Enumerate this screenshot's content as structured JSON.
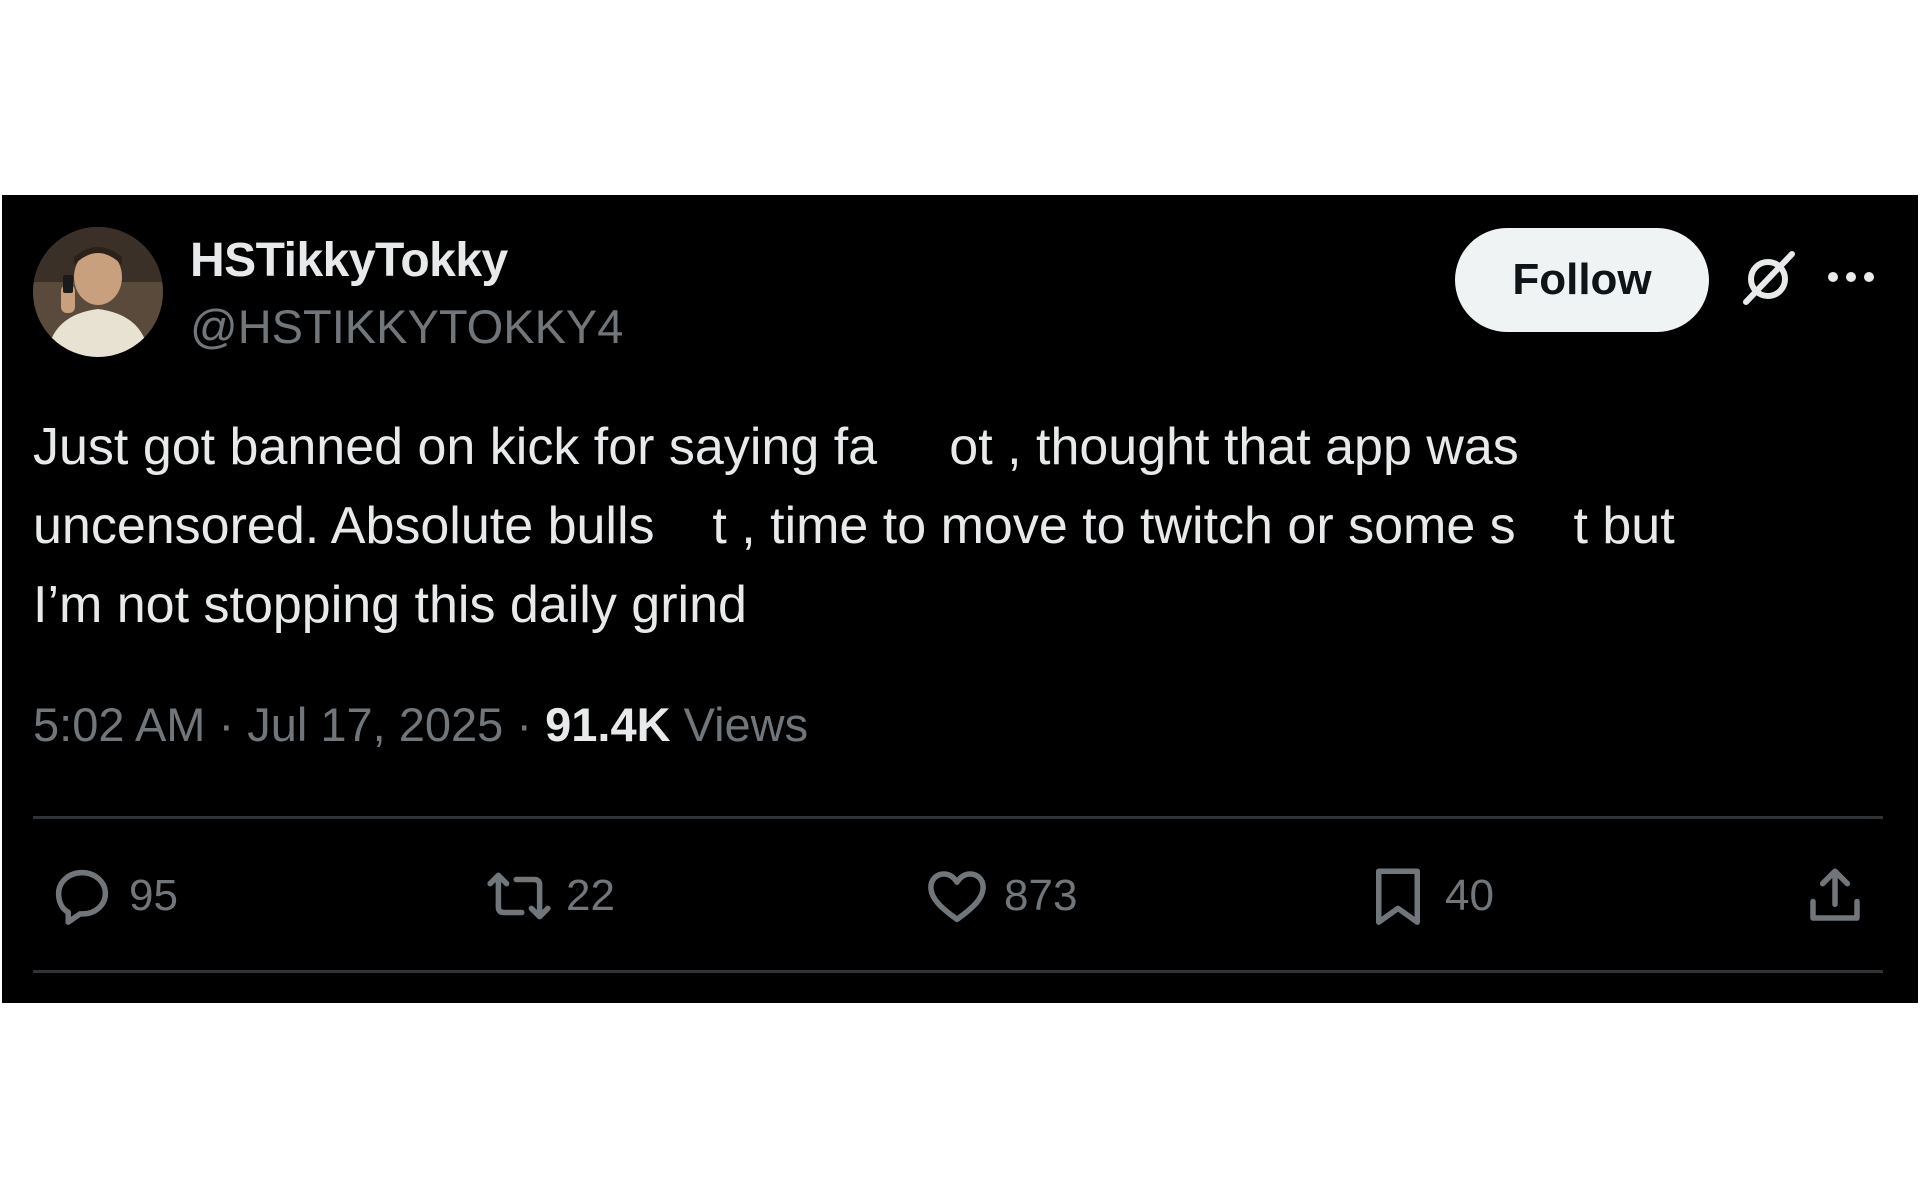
{
  "author": {
    "display_name": "HSTikkyTokky",
    "handle": "@HSTIKKYTOKKY4",
    "avatar_icon": "profile-photo"
  },
  "header": {
    "follow_label": "Follow",
    "grok_icon": "grok-icon",
    "more_icon": "more-icon"
  },
  "tweet": {
    "lines": [
      "Just got banned on kick for saying fa     ot , thought that app was",
      "uncensored. Absolute bulls    t , time to move to twitch or some s    t but",
      "I’m not stopping this daily grind"
    ]
  },
  "meta": {
    "time": "5:02 AM",
    "separator": "·",
    "date": "Jul 17, 2025",
    "views_count": "91.4K",
    "views_label": "Views"
  },
  "actions": {
    "reply_count": "95",
    "retweet_count": "22",
    "like_count": "873",
    "bookmark_count": "40"
  },
  "colors": {
    "background": "#000000",
    "text": "#e7e9ea",
    "secondary": "#71767b",
    "divider": "#2f3336",
    "follow_bg": "#eff3f4"
  }
}
